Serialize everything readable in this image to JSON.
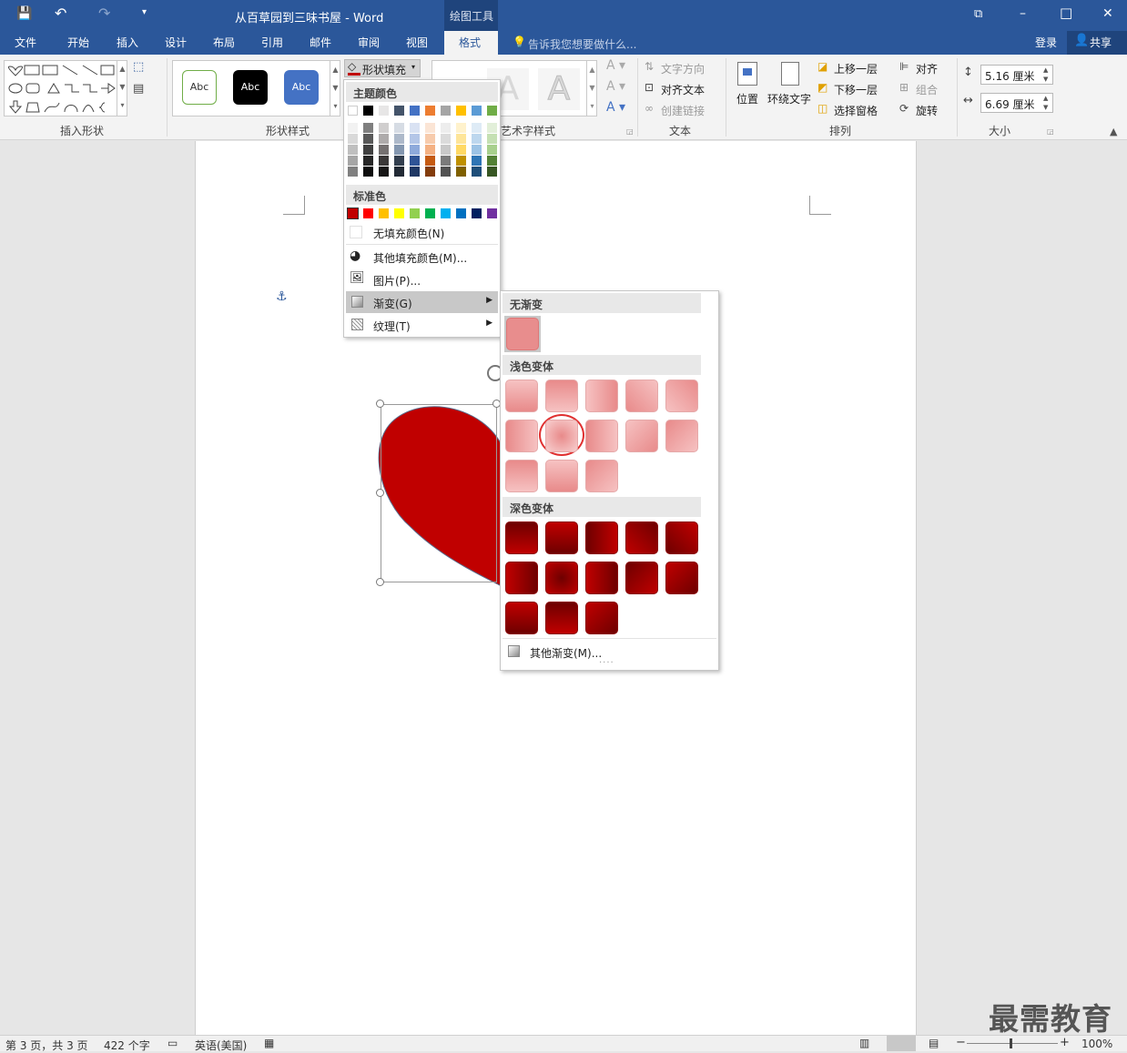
{
  "titlebar": {
    "doc_title": "从百草园到三味书屋 - Word",
    "context_tab": "绘图工具",
    "btn_restore": "⧉",
    "btn_min": "–",
    "btn_max": "□",
    "btn_close": "✕"
  },
  "qat": {
    "save": "💾",
    "undo": "↶",
    "redo": "↷",
    "more": "▾"
  },
  "tabs": [
    "文件",
    "开始",
    "插入",
    "设计",
    "布局",
    "引用",
    "邮件",
    "审阅",
    "视图",
    "格式"
  ],
  "tell_me": "告诉我您想要做什么...",
  "login": "登录",
  "share": "共享",
  "ribbon": {
    "groups": {
      "insert_shapes": "插入形状",
      "shape_styles": "形状样式",
      "art_styles": "艺术字样式",
      "text": "文本",
      "arrange": "排列",
      "size": "大小"
    },
    "style_abc": [
      "Abc",
      "Abc",
      "Abc"
    ],
    "shape_fill": "形状填充",
    "text_direction": "文字方向",
    "align_text": "对齐文本",
    "create_link": "创建链接",
    "position": "位置",
    "wrap_text": "环绕文字",
    "bring_forward": "上移一层",
    "send_backward": "下移一层",
    "selection_pane": "选择窗格",
    "align": "对齐",
    "group": "组合",
    "rotate": "旋转",
    "height": "5.16 厘米",
    "width": "6.69 厘米"
  },
  "fill_menu": {
    "theme_colors": "主题颜色",
    "standard_colors": "标准色",
    "no_fill": "无填充颜色(N)",
    "more_colors": "其他填充颜色(M)...",
    "picture": "图片(P)...",
    "gradient": "渐变(G)",
    "texture": "纹理(T)",
    "theme_top": [
      "#ffffff",
      "#000000",
      "#e7e6e6",
      "#44546a",
      "#4472c4",
      "#ed7d31",
      "#a5a5a5",
      "#ffc000",
      "#5b9bd5",
      "#70ad47"
    ],
    "theme_shades": [
      [
        "#f2f2f2",
        "#d9d9d9",
        "#bfbfbf",
        "#a6a6a6",
        "#808080"
      ],
      [
        "#7f7f7f",
        "#595959",
        "#404040",
        "#262626",
        "#0d0d0d"
      ],
      [
        "#d0cece",
        "#aeabab",
        "#757171",
        "#3a3838",
        "#171616"
      ],
      [
        "#d6dce4",
        "#adb9ca",
        "#8497b0",
        "#333f4f",
        "#222a35"
      ],
      [
        "#d9e2f3",
        "#b4c6e7",
        "#8eaadb",
        "#2f5496",
        "#1f3864"
      ],
      [
        "#fbe5d5",
        "#f7cbac",
        "#f4b183",
        "#c55a11",
        "#833c0b"
      ],
      [
        "#ededed",
        "#dbdbdb",
        "#c9c9c9",
        "#7b7b7b",
        "#525252"
      ],
      [
        "#fff2cc",
        "#fee599",
        "#ffd965",
        "#bf9000",
        "#7f6000"
      ],
      [
        "#deebf6",
        "#bdd7ee",
        "#9cc3e5",
        "#2e75b5",
        "#1e4e79"
      ],
      [
        "#e2efd9",
        "#c5e0b3",
        "#a8d08d",
        "#538135",
        "#375623"
      ]
    ],
    "standard": [
      "#c00000",
      "#ff0000",
      "#ffc000",
      "#ffff00",
      "#92d050",
      "#00b050",
      "#00b0f0",
      "#0070c0",
      "#002060",
      "#7030a0"
    ]
  },
  "gradient_menu": {
    "no_gradient": "无渐变",
    "light_variations": "浅色变体",
    "dark_variations": "深色变体",
    "more_gradients": "其他渐变(M)...",
    "grip": "...."
  },
  "statusbar": {
    "page": "第 3 页，共 3 页",
    "words": "422 个字",
    "lang": "英语(美国)",
    "zoom": "100%"
  },
  "watermark": "最需教育"
}
